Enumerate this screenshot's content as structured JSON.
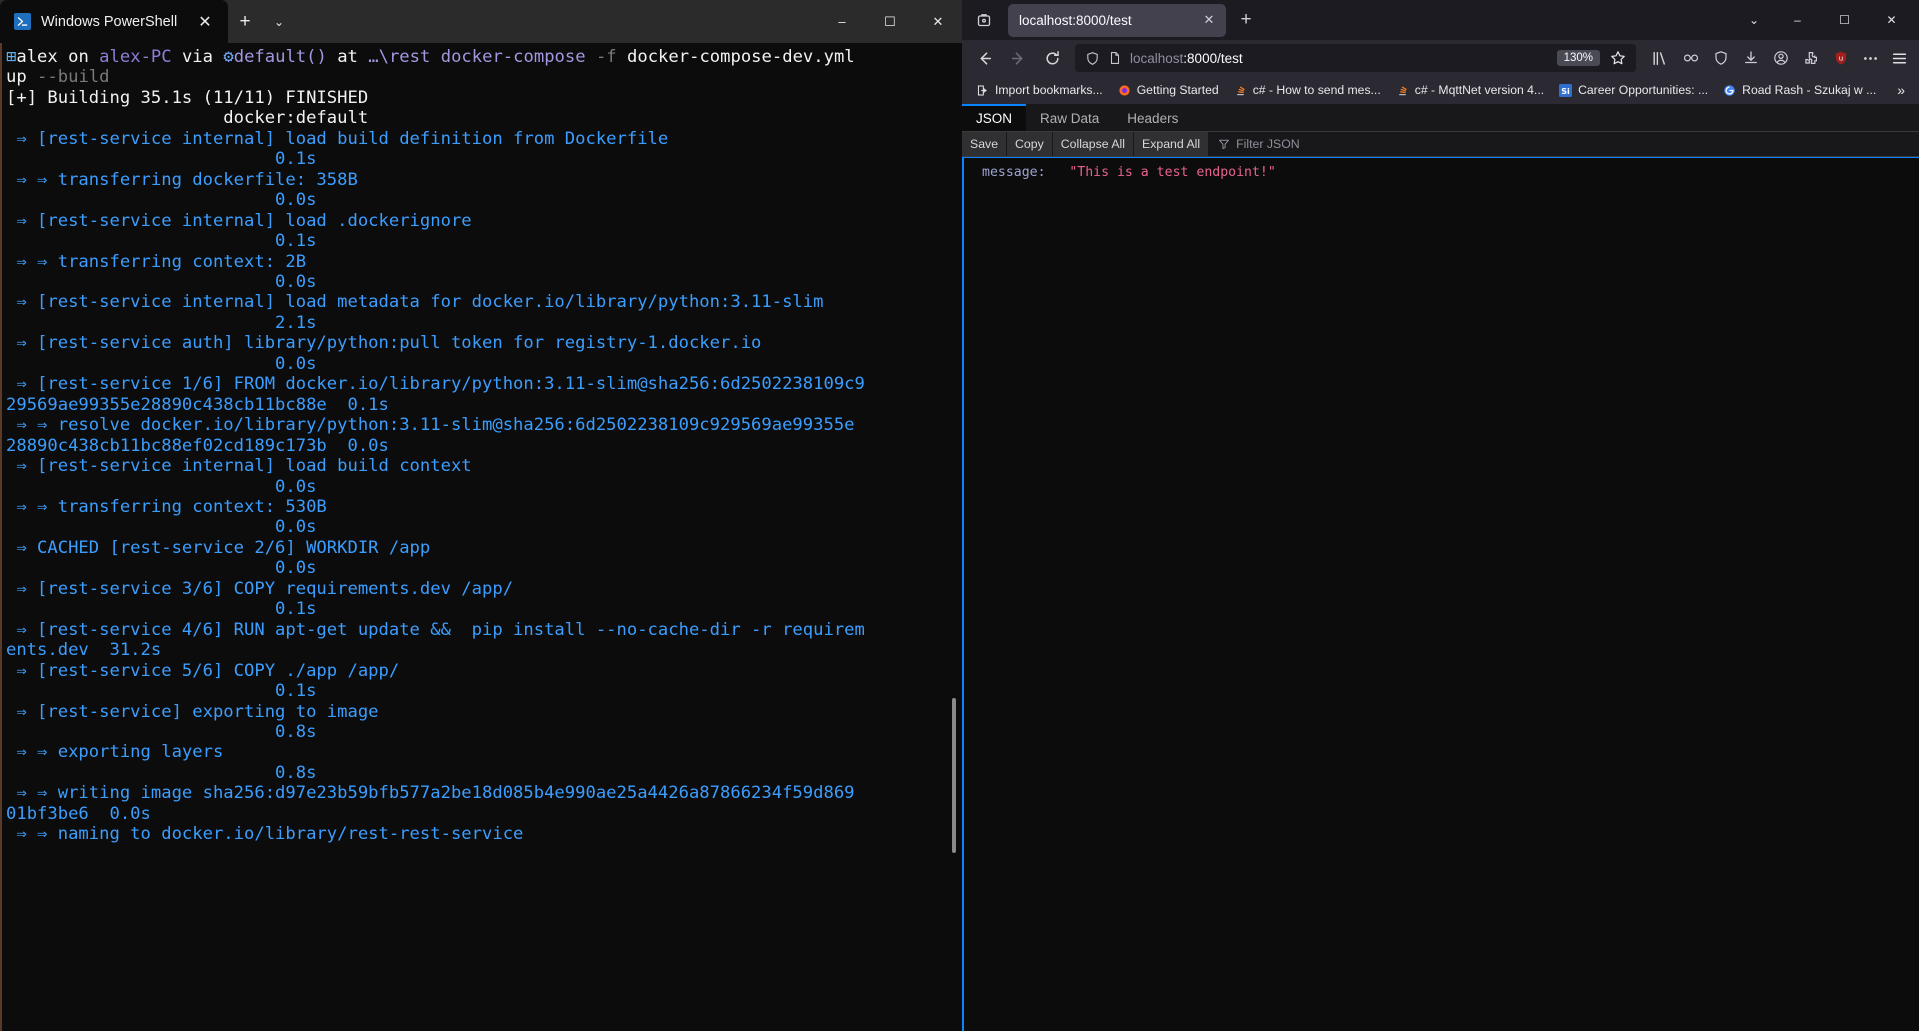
{
  "powershell": {
    "tab": {
      "title": "Windows PowerShell",
      "icon": "powershell-icon",
      "close_label": "✕"
    },
    "new_tab_label": "+",
    "dropdown_label": "⌄",
    "window_controls": {
      "minimize": "–",
      "maximize": "☐",
      "close": "✕"
    },
    "prompt": {
      "user": "alex",
      "on": " on ",
      "host": "alex-PC",
      "via": " via ",
      "env_icon": "⚙",
      "env": "default()",
      "at": " at ",
      "path": "…\\rest",
      "command": "docker-compose",
      "flag": "-f",
      "file": "docker-compose-dev.yml",
      "continuation": "up",
      "build_flag": "--build"
    },
    "build_header": "[+] Building 35.1s (11/11) FINISHED",
    "builder": "docker:default",
    "steps": [
      {
        "text": " ⇒ [rest-service internal] load build definition from Dockerfile",
        "time": "0.1s"
      },
      {
        "text": " ⇒ ⇒ transferring dockerfile: 358B",
        "time": "0.0s"
      },
      {
        "text": " ⇒ [rest-service internal] load .dockerignore",
        "time": "0.1s"
      },
      {
        "text": " ⇒ ⇒ transferring context: 2B",
        "time": "0.0s"
      },
      {
        "text": " ⇒ [rest-service internal] load metadata for docker.io/library/python:3.11-slim",
        "time": "2.1s"
      },
      {
        "text": " ⇒ [rest-service auth] library/python:pull token for registry-1.docker.io",
        "time": "0.0s"
      },
      {
        "text": " ⇒ [rest-service 1/6] FROM docker.io/library/python:3.11-slim@sha256:6d2502238109c9",
        "wrap": "29569ae99355e28890c438cb11bc88e",
        "time": "0.1s",
        "inline_time": true
      },
      {
        "text": " ⇒ ⇒ resolve docker.io/library/python:3.11-slim@sha256:6d2502238109c929569ae99355e",
        "wrap": "28890c438cb11bc88ef02cd189c173b",
        "time": "0.0s",
        "inline_time": true
      },
      {
        "text": " ⇒ [rest-service internal] load build context",
        "time": "0.0s"
      },
      {
        "text": " ⇒ ⇒ transferring context: 530B",
        "time": "0.0s"
      },
      {
        "text": " ⇒ CACHED [rest-service 2/6] WORKDIR /app",
        "time": "0.0s"
      },
      {
        "text": " ⇒ [rest-service 3/6] COPY requirements.dev /app/",
        "time": "0.1s"
      },
      {
        "text": " ⇒ [rest-service 4/6] RUN apt-get update &&  pip install --no-cache-dir -r requirem",
        "wrap": "ents.dev",
        "time": "31.2s",
        "inline_time": true
      },
      {
        "text": " ⇒ [rest-service 5/6] COPY ./app /app/",
        "time": "0.1s"
      },
      {
        "text": " ⇒ [rest-service] exporting to image",
        "time": "0.8s"
      },
      {
        "text": " ⇒ ⇒ exporting layers",
        "time": "0.8s"
      },
      {
        "text": " ⇒ ⇒ writing image sha256:d97e23b59bfb577a2be18d085b4e990ae25a4426a87866234f59d869",
        "wrap": "01bf3be6",
        "time": "0.0s",
        "inline_time": true
      },
      {
        "text": " ⇒ ⇒ naming to docker.io/library/rest-rest-service",
        "time": ""
      }
    ]
  },
  "firefox": {
    "firefox_view_icon": "firefox-view-icon",
    "tabs": [
      {
        "label": "localhost:8000/test",
        "close_label": "✕",
        "active": true
      }
    ],
    "new_tab_label": "+",
    "tab_list_chevron": "⌄",
    "window_controls": {
      "minimize": "–",
      "maximize": "☐",
      "close": "✕"
    },
    "nav": {
      "back_icon": "back-arrow-icon",
      "forward_icon": "forward-arrow-icon",
      "reload_icon": "reload-icon"
    },
    "urlbar": {
      "shield_icon": "shield-icon",
      "page_icon": "page-icon",
      "url_host": "localhost",
      "url_path": ":8000/test",
      "zoom_level": "130%",
      "bookmark_icon": "star-icon",
      "reader_icon": "reader-view-icon"
    },
    "toolbar_icons": [
      {
        "name": "library-icon"
      },
      {
        "name": "extension-link-icon"
      },
      {
        "name": "shield-extension-icon"
      },
      {
        "name": "downloads-icon"
      },
      {
        "name": "account-icon"
      },
      {
        "name": "extensions-puzzle-icon"
      },
      {
        "name": "ublock-origin-icon",
        "badge": "u"
      },
      {
        "name": "overflow-menu-icon"
      },
      {
        "name": "app-menu-icon"
      }
    ],
    "bookmarks": [
      {
        "label": "Import bookmarks...",
        "icon": "import-icon"
      },
      {
        "label": "Getting Started",
        "icon": "firefox-icon"
      },
      {
        "label": "c# - How to send mes...",
        "icon": "stackoverflow-icon"
      },
      {
        "label": "c# - MqttNet version 4...",
        "icon": "stackoverflow-icon"
      },
      {
        "label": "Career Opportunities: ...",
        "icon": "si-icon"
      },
      {
        "label": "Road Rash - Szukaj w ...",
        "icon": "google-icon"
      }
    ],
    "bookmarks_overflow": "»"
  },
  "json_viewer": {
    "tabs": [
      {
        "label": "JSON",
        "active": true
      },
      {
        "label": "Raw Data",
        "active": false
      },
      {
        "label": "Headers",
        "active": false
      }
    ],
    "toolbar": {
      "save": "Save",
      "copy": "Copy",
      "collapse_all": "Collapse All",
      "expand_all": "Expand All",
      "filter_icon": "filter-icon",
      "filter_placeholder": "Filter JSON"
    },
    "rows": [
      {
        "key": "message:",
        "value": "\"This is a test endpoint!\""
      }
    ]
  }
}
